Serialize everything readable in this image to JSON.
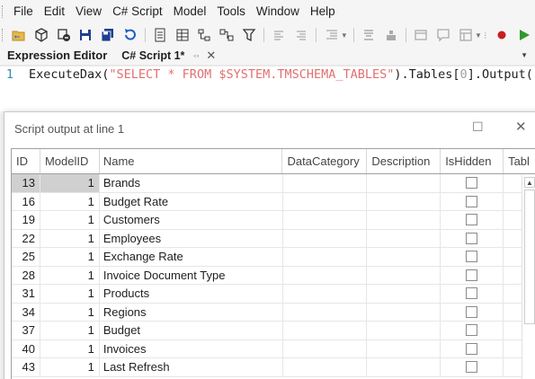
{
  "menu": [
    "File",
    "Edit",
    "View",
    "C# Script",
    "Model",
    "Tools",
    "Window",
    "Help"
  ],
  "toolbar": {
    "icons": [
      "open-folder-icon",
      "model-icon",
      "deploy-icon",
      "save-icon",
      "save-all-icon",
      "undo-icon",
      "document-icon",
      "table-icon",
      "hierarchy-icon",
      "relationship-icon",
      "filter-icon",
      "align-left-icon",
      "align-right-icon",
      "indent-icon",
      "format-icon",
      "tag-icon",
      "window-icon",
      "comment-icon",
      "column-icon",
      "record-icon",
      "run-icon"
    ]
  },
  "tabs": {
    "panel_title": "Expression Editor",
    "active_tab": "C# Script 1*",
    "pin_glyph": "⇔",
    "close_glyph": "✕"
  },
  "editor": {
    "line_number": "1",
    "code_fn": "ExecuteDax(",
    "code_str": "\"SELECT * FROM $SYSTEM.TMSCHEMA_TABLES\"",
    "code_mid": ").Tables[",
    "code_num": "0",
    "code_end": "].Output();"
  },
  "output": {
    "title": "Script output at line 1",
    "columns": [
      "ID",
      "ModelID",
      "Name",
      "DataCategory",
      "Description",
      "IsHidden",
      "Tabl"
    ],
    "rows": [
      {
        "id": "13",
        "model": "1",
        "name": "Brands"
      },
      {
        "id": "16",
        "model": "1",
        "name": "Budget Rate"
      },
      {
        "id": "19",
        "model": "1",
        "name": "Customers"
      },
      {
        "id": "22",
        "model": "1",
        "name": "Employees"
      },
      {
        "id": "25",
        "model": "1",
        "name": "Exchange Rate"
      },
      {
        "id": "28",
        "model": "1",
        "name": "Invoice Document Type"
      },
      {
        "id": "31",
        "model": "1",
        "name": "Products"
      },
      {
        "id": "34",
        "model": "1",
        "name": "Regions"
      },
      {
        "id": "37",
        "model": "1",
        "name": "Budget"
      },
      {
        "id": "40",
        "model": "1",
        "name": "Invoices"
      },
      {
        "id": "43",
        "model": "1",
        "name": "Last Refresh"
      }
    ],
    "selected_row_index": 0
  },
  "colors": {
    "string": "#e07070",
    "number": "#a0a0a0",
    "line_number": "#2b91af",
    "selection": "#d0d0d0"
  }
}
